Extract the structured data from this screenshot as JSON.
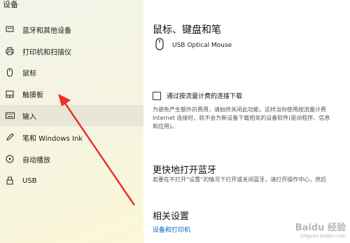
{
  "sidebar": {
    "title": "设备",
    "items": [
      {
        "label": "蓝牙和其他设备",
        "icon": "bluetooth-devices-icon"
      },
      {
        "label": "打印机和扫描仪",
        "icon": "printer-icon"
      },
      {
        "label": "鼠标",
        "icon": "mouse-icon"
      },
      {
        "label": "触摸板",
        "icon": "touchpad-icon"
      },
      {
        "label": "输入",
        "icon": "keyboard-icon"
      },
      {
        "label": "笔和 Windows Ink",
        "icon": "pen-icon"
      },
      {
        "label": "自动播放",
        "icon": "autoplay-icon"
      },
      {
        "label": "USB",
        "icon": "usb-icon"
      }
    ]
  },
  "main": {
    "section_title": "鼠标、键盘和笔",
    "device_name": "USB Optical Mouse",
    "metered_checkbox_label": "通过按流量计费的连接下载",
    "metered_desc_line1": "为避免产生额外的费用，请始终关闭此功能，这样当你使用按流量计费",
    "metered_desc_line2": "Internet 连接时，就不会为新设备下载相关的设备软件(驱动程序、信息",
    "metered_desc_line3": "和应用)。",
    "bluetooth_title": "更快地打开蓝牙",
    "bluetooth_desc": "若要在不打开“设置”的情况下打开或关闭蓝牙，请打开操作中心，然后",
    "related_title": "相关设置",
    "related_link": "设备和打印机"
  },
  "watermark": {
    "brand": "Baidu 经验",
    "url": "jingyan.baidu.com"
  },
  "colors": {
    "accent": "#0a63c9",
    "annotation_arrow": "#e5342a"
  }
}
